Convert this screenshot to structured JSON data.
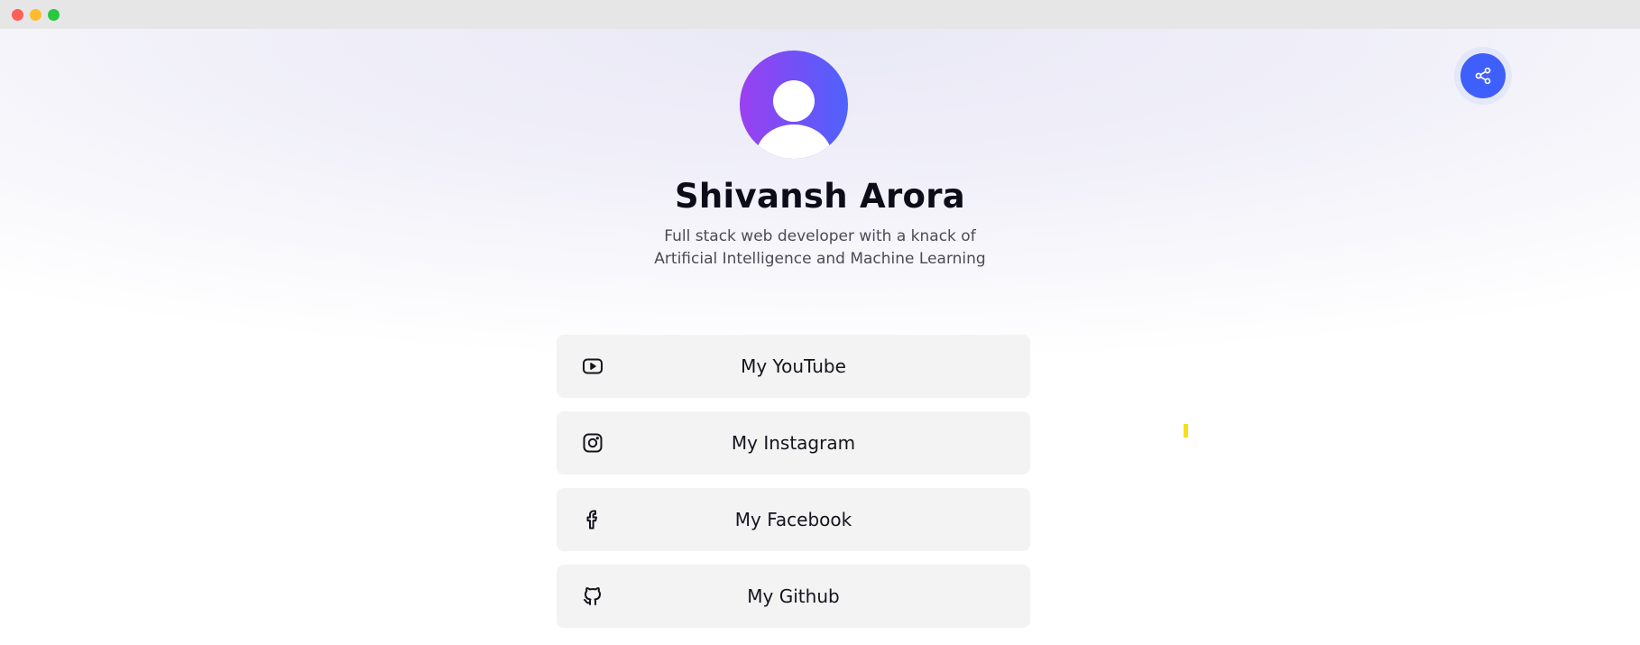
{
  "window": {
    "controls": [
      "close",
      "minimize",
      "maximize"
    ]
  },
  "share": {
    "icon": "share-icon",
    "color": "#3e5ffb"
  },
  "profile": {
    "avatar_icon": "user-avatar-icon",
    "avatar_gradient": [
      "#9b40f0",
      "#4f62fc"
    ],
    "name": "Shivansh Arora",
    "bio_line1": "Full stack web developer with a knack of",
    "bio_line2": "Artificial Intelligence and Machine Learning"
  },
  "links": [
    {
      "label": "My YouTube",
      "icon": "youtube-icon"
    },
    {
      "label": "My Instagram",
      "icon": "instagram-icon"
    },
    {
      "label": "My Facebook",
      "icon": "facebook-icon"
    },
    {
      "label": "My Github",
      "icon": "github-icon"
    }
  ]
}
